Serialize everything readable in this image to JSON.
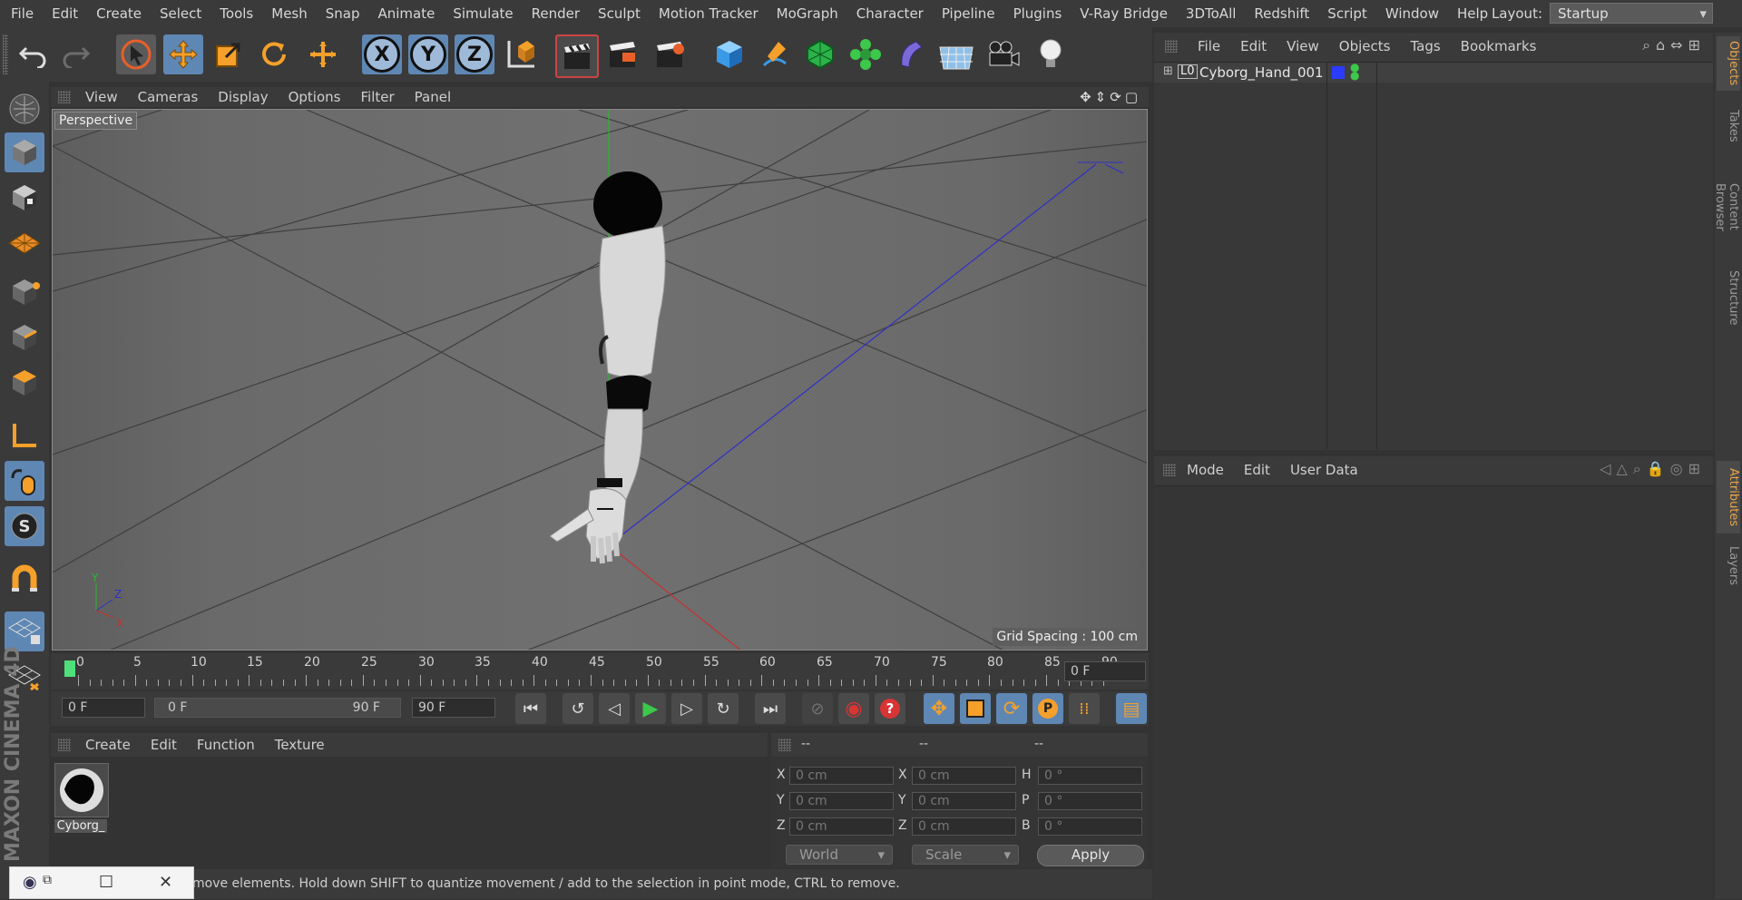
{
  "menubar": {
    "items": [
      "File",
      "Edit",
      "Create",
      "Select",
      "Tools",
      "Mesh",
      "Snap",
      "Animate",
      "Simulate",
      "Render",
      "Sculpt",
      "Motion Tracker",
      "MoGraph",
      "Character",
      "Pipeline",
      "Plugins",
      "V-Ray Bridge",
      "3DToAll",
      "Redshift",
      "Script",
      "Window",
      "Help"
    ],
    "layout_label": "Layout:",
    "layout_value": "Startup"
  },
  "toolbar": {
    "axis_x": "X",
    "axis_y": "Y",
    "axis_z": "Z"
  },
  "viewport": {
    "menu": [
      "View",
      "Cameras",
      "Display",
      "Options",
      "Filter",
      "Panel"
    ],
    "camera_label": "Perspective",
    "grid_spacing": "Grid Spacing : 100 cm",
    "axis_labels": {
      "x": "X",
      "y": "Y",
      "z": "Z"
    }
  },
  "timeline": {
    "ticks": [
      "0",
      "5",
      "10",
      "15",
      "20",
      "25",
      "30",
      "35",
      "40",
      "45",
      "50",
      "55",
      "60",
      "65",
      "70",
      "75",
      "80",
      "85",
      "90"
    ],
    "current_frame": "0 F",
    "start_field": "0 F",
    "range_start": "0 F",
    "range_end": "90 F",
    "end_field": "90 F"
  },
  "materials": {
    "menu": [
      "Create",
      "Edit",
      "Function",
      "Texture"
    ],
    "items": [
      {
        "name": "Cyborg_"
      }
    ]
  },
  "coordinates": {
    "header": [
      "--",
      "--",
      "--"
    ],
    "rows": [
      {
        "l1": "X",
        "v1": "0 cm",
        "l2": "X",
        "v2": "0 cm",
        "l3": "H",
        "v3": "0 °"
      },
      {
        "l1": "Y",
        "v1": "0 cm",
        "l2": "Y",
        "v2": "0 cm",
        "l3": "P",
        "v3": "0 °"
      },
      {
        "l1": "Z",
        "v1": "0 cm",
        "l2": "Z",
        "v2": "0 cm",
        "l3": "B",
        "v3": "0 °"
      }
    ],
    "mode_select": "World",
    "scale_select": "Scale",
    "apply": "Apply"
  },
  "objects": {
    "menu": [
      "File",
      "Edit",
      "View",
      "Objects",
      "Tags",
      "Bookmarks"
    ],
    "items": [
      {
        "name": "Cyborg_Hand_001",
        "color": "#2a3cff"
      }
    ]
  },
  "attributes": {
    "menu": [
      "Mode",
      "Edit",
      "User Data"
    ]
  },
  "sidetabs": {
    "top": [
      "Objects",
      "Takes",
      "Content Browser",
      "Structure"
    ],
    "bottom": [
      "Attributes",
      "Layers"
    ]
  },
  "statusbar": {
    "text": "move elements. Hold down SHIFT to quantize movement / add to the selection in point mode, CTRL to remove."
  },
  "brand": "MAXON CINEMA 4D",
  "colors": {
    "accent_blue": "#5f87b3",
    "orange": "#e8a54a",
    "play_green": "#3cc84a",
    "record_red": "#d93434"
  }
}
